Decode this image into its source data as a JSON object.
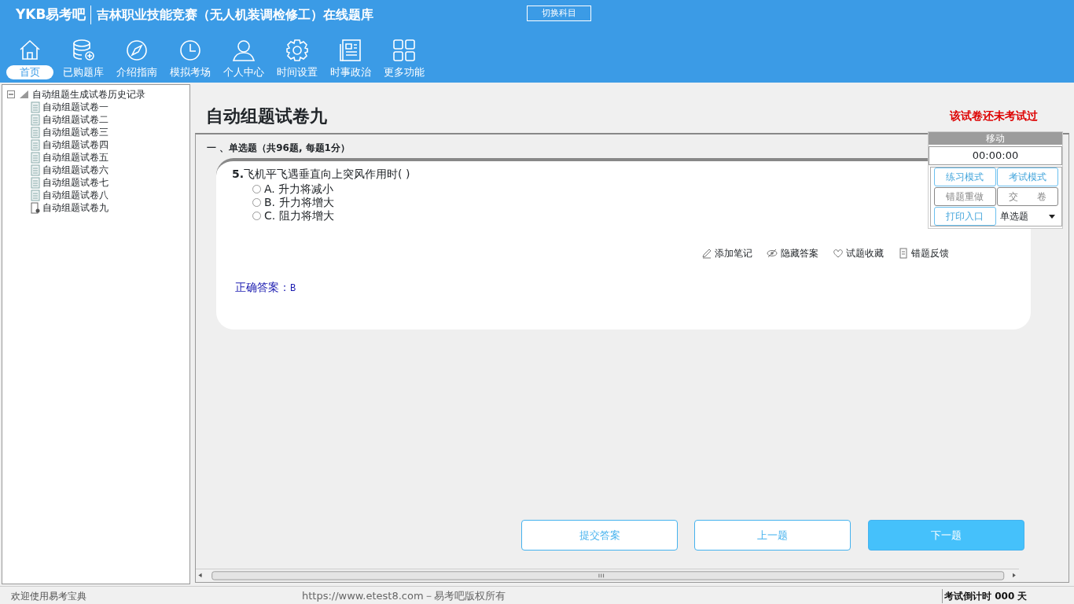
{
  "app": {
    "logo": "YKB易考吧",
    "title": "吉林职业技能竞赛（无人机装调检修工）在线题库",
    "switch_button": "切换科目"
  },
  "nav": [
    {
      "label": "首页",
      "kind": "home",
      "selected": true
    },
    {
      "label": "已购题库",
      "kind": "database",
      "selected": false
    },
    {
      "label": "介绍指南",
      "kind": "compass",
      "selected": false
    },
    {
      "label": "模拟考场",
      "kind": "clock",
      "selected": false
    },
    {
      "label": "个人中心",
      "kind": "user",
      "selected": false
    },
    {
      "label": "时间设置",
      "kind": "gear",
      "selected": false
    },
    {
      "label": "时事政治",
      "kind": "news",
      "selected": false
    },
    {
      "label": "更多功能",
      "kind": "grid",
      "selected": false
    }
  ],
  "tree": {
    "label": "自动组题生成试卷历史记录",
    "expanded": true,
    "children": [
      {
        "label": "自动组题试卷一",
        "selected": false
      },
      {
        "label": "自动组题试卷二",
        "selected": false
      },
      {
        "label": "自动组题试卷三",
        "selected": false
      },
      {
        "label": "自动组题试卷四",
        "selected": false
      },
      {
        "label": "自动组题试卷五",
        "selected": false
      },
      {
        "label": "自动组题试卷六",
        "selected": false
      },
      {
        "label": "自动组题试卷七",
        "selected": false
      },
      {
        "label": "自动组题试卷八",
        "selected": false
      },
      {
        "label": "自动组题试卷九",
        "selected": true
      }
    ]
  },
  "paper": {
    "title": "自动组题试卷九",
    "status": "该试卷还未考试过"
  },
  "section": "一 、单选题（共96题, 每题1分）",
  "question": {
    "number": "5.",
    "text": "飞机平飞遇垂直向上突风作用时( )",
    "options": [
      {
        "label": "A. 升力将减小",
        "selected": false
      },
      {
        "label": "B. 升力将增大",
        "selected": false
      },
      {
        "label": "C. 阻力将增大",
        "selected": false
      }
    ]
  },
  "tools": [
    {
      "label": "添加笔记",
      "kind": "pencil"
    },
    {
      "label": "隐藏答案",
      "kind": "eye"
    },
    {
      "label": "试题收藏",
      "kind": "heart"
    },
    {
      "label": "错题反馈",
      "kind": "doc"
    }
  ],
  "answer": {
    "label": "正确答案：",
    "value": "B"
  },
  "panel": {
    "move_label": "移动",
    "timer": "00:00:00",
    "buttons": [
      {
        "label": "练习模式",
        "disabled": false
      },
      {
        "label": "考试模式",
        "disabled": false
      },
      {
        "label": "错题重做",
        "disabled": true
      },
      {
        "label": "交　　卷",
        "disabled": true
      },
      {
        "label": "打印入口",
        "disabled": false
      }
    ],
    "type_select": "单选题"
  },
  "footer_buttons": [
    {
      "label": "提交答案",
      "primary": false
    },
    {
      "label": "上一题",
      "primary": false
    },
    {
      "label": "下一题",
      "primary": true
    }
  ],
  "status_bar": {
    "welcome": "欢迎使用易考宝典",
    "copyright": "https://www.etest8.com－易考吧版权所有",
    "countdown": "考试倒计时 000 天"
  }
}
